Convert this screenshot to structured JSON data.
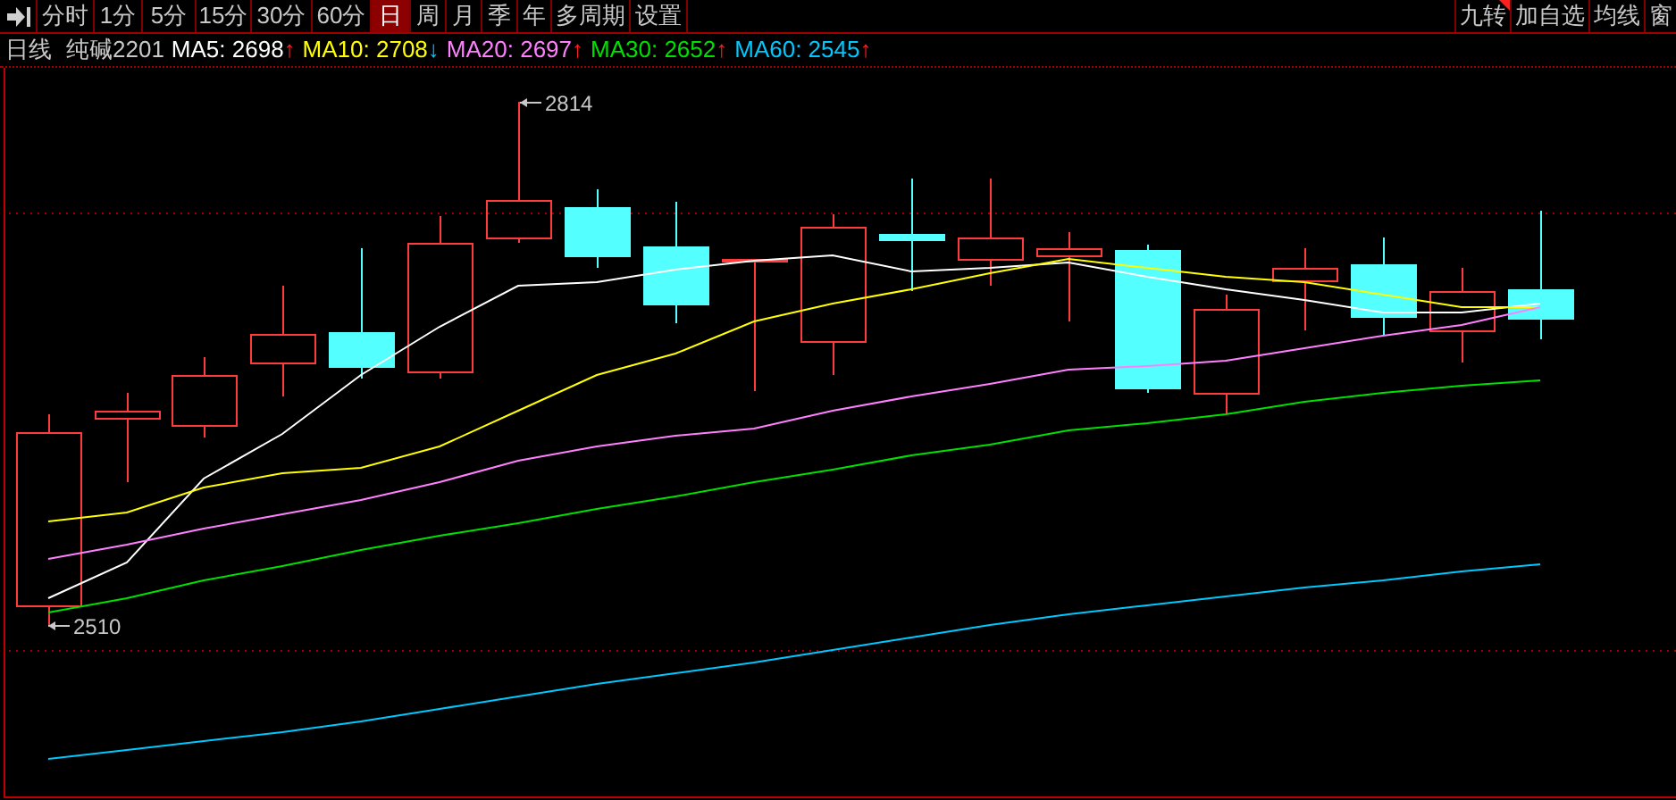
{
  "toolbar": {
    "tabs": [
      {
        "label": "分时",
        "selected": false
      },
      {
        "label": "1分",
        "selected": false
      },
      {
        "label": "5分",
        "selected": false
      },
      {
        "label": "15分",
        "selected": false
      },
      {
        "label": "30分",
        "selected": false
      },
      {
        "label": "60分",
        "selected": false
      },
      {
        "label": "日",
        "selected": true
      },
      {
        "label": "周",
        "selected": false
      },
      {
        "label": "月",
        "selected": false
      },
      {
        "label": "季",
        "selected": false
      },
      {
        "label": "年",
        "selected": false
      },
      {
        "label": "多周期",
        "selected": false
      },
      {
        "label": "设置",
        "selected": false
      }
    ],
    "right_buttons": [
      "九转",
      "加自选",
      "均线",
      "窗"
    ]
  },
  "info": {
    "period": "日线",
    "symbol": "纯碱2201",
    "indicators": [
      {
        "name": "MA5:",
        "value": "2698",
        "arrow": "↑",
        "rising": true,
        "color": "#ffffff"
      },
      {
        "name": "MA10:",
        "value": "2708",
        "arrow": "↓",
        "rising": false,
        "color": "#ffff00"
      },
      {
        "name": "MA20:",
        "value": "2697",
        "arrow": "↑",
        "rising": true,
        "color": "#ff80ff"
      },
      {
        "name": "MA30:",
        "value": "2652",
        "arrow": "↑",
        "rising": true,
        "color": "#00e000"
      },
      {
        "name": "MA60:",
        "value": "2545",
        "arrow": "↑",
        "rising": true,
        "color": "#00c8ff"
      }
    ]
  },
  "chart": {
    "high_label": "2814",
    "low_label": "2510"
  }
}
